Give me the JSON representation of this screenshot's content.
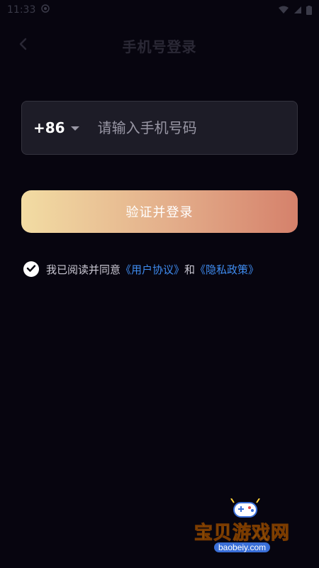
{
  "status_bar": {
    "time": "11:33"
  },
  "header": {
    "title": "手机号登录"
  },
  "phone": {
    "country_code": "+86",
    "placeholder": "请输入手机号码"
  },
  "login_button": {
    "label": "验证并登录"
  },
  "agreement": {
    "checked": true,
    "prefix": "我已阅读并同意",
    "user_agreement": "《用户协议》",
    "conjunction": "和",
    "privacy_policy": "《隐私政策》"
  },
  "watermark": {
    "title": "宝贝游戏网",
    "url": "baobeiy.com"
  },
  "colors": {
    "background": "#07050f",
    "input_bg": "#1d1c27",
    "link": "#3f8cf0",
    "button_gradient": [
      "#f2dca3",
      "#d5816b"
    ]
  }
}
